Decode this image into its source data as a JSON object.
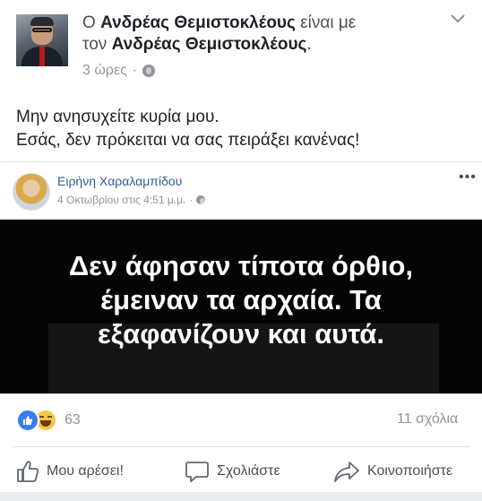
{
  "post": {
    "author": {
      "prefix": "Ο ",
      "name": "Ανδρέας Θεμιστοκλέους",
      "middle": " είναι με",
      "second_line_prefix": "τον ",
      "tagged": "Ανδρέας Θεμιστοκλέους",
      "suffix": "."
    },
    "time": "3 ώρες",
    "privacy_icon": "globe-icon",
    "text_lines": [
      "Μην ανησυχείτε κυρία μου.",
      "Εσάς, δεν πρόκειται να σας πειράξει κανένας!"
    ]
  },
  "shared": {
    "author": "Ειρήνη Χαραλαμπίδου",
    "date": "4 Οκτωβρίου στις 4:51 μ.μ.",
    "separator": "·",
    "image_text": [
      "Δεν άφησαν τίποτα όρθιο,",
      "έμειναν τα αρχαία. Τα",
      "εξαφανίζουν και αυτά."
    ]
  },
  "stats": {
    "reactions_count": "63",
    "comments": "11 σχόλια"
  },
  "actions": {
    "like": "Μου αρέσει!",
    "comment": "Σχολιάστε",
    "share": "Κοινοποιήστε"
  },
  "colors": {
    "link": "#365899",
    "muted": "#90949c",
    "text": "#1d2129",
    "like_blue": "#3b7cf1",
    "haha_yellow": "#f7c744"
  }
}
